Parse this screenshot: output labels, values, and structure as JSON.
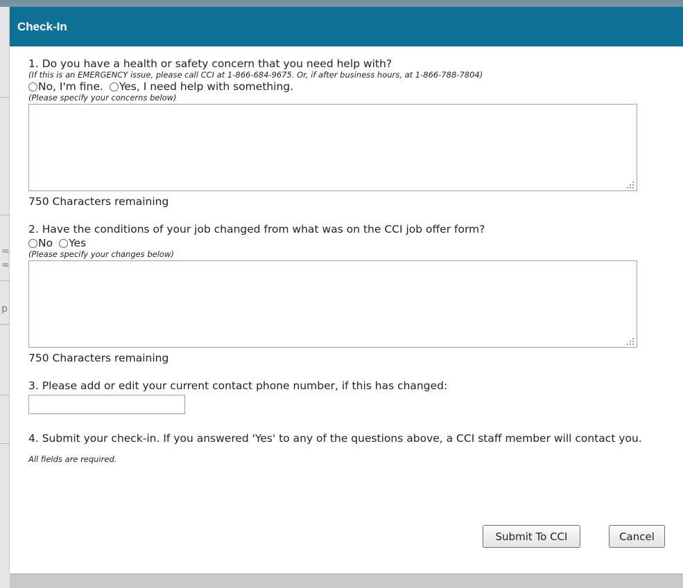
{
  "dialog": {
    "title": "Check-In"
  },
  "q1": {
    "question": "1. Do you have a health or safety concern that you need help with?",
    "emergency_note": "(If this is an EMERGENCY issue, please call CCI at 1-866-684-9675. Or, if after business hours, at 1-866-788-7804)",
    "option_no": "No, I'm fine.",
    "option_yes": "Yes, I need help with something.",
    "specify_hint": "(Please specify your concerns below)",
    "textarea_value": "",
    "remaining": "750 Characters remaining"
  },
  "q2": {
    "question": "2. Have the conditions of your job changed from what was on the CCI job offer form?",
    "option_no": "No",
    "option_yes": "Yes",
    "specify_hint": "(Please specify your changes below)",
    "textarea_value": "",
    "remaining": "750 Characters remaining"
  },
  "q3": {
    "question": "3. Please add or edit your current contact phone number, if this has changed:",
    "phone_value": ""
  },
  "q4": {
    "text": "4. Submit your check-in. If you answered 'Yes' to any of the questions above, a CCI staff member will contact you."
  },
  "all_fields_required": "All fields are required.",
  "buttons": {
    "submit": "Submit To CCI",
    "cancel": "Cancel"
  },
  "colors": {
    "titlebar": "#0f7096",
    "input_border": "#8fa8be"
  }
}
